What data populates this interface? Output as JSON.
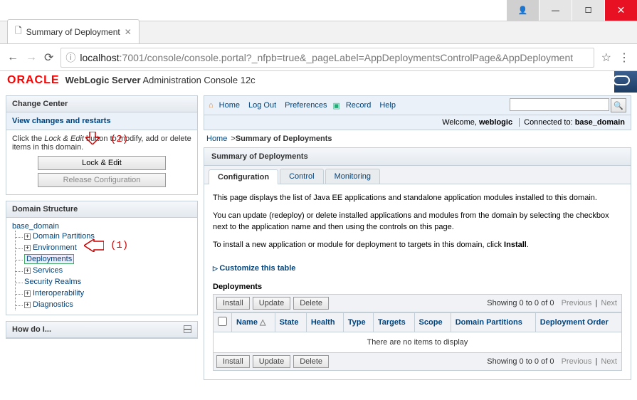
{
  "window": {
    "tab_title": "Summary of Deployment",
    "url_host": "localhost",
    "url_port": ":7001",
    "url_path": "/console/console.portal?_nfpb=true&_pageLabel=AppDeploymentsControlPage&AppDeployment"
  },
  "brand": {
    "logo": "ORACLE",
    "product": "WebLogic Server",
    "sub": "Administration Console 12c"
  },
  "toolbar": {
    "home": "Home",
    "logout": "Log Out",
    "prefs": "Preferences",
    "record": "Record",
    "help": "Help"
  },
  "welcome": {
    "greeting": "Welcome,",
    "user": "weblogic",
    "connected_label": "Connected to:",
    "domain": "base_domain"
  },
  "change_center": {
    "title": "Change Center",
    "view_link": "View changes and restarts",
    "instruction_pre": "Click the ",
    "instruction_em": "Lock & Edit",
    "instruction_post": " button to modify, add or delete items in this domain.",
    "lock_btn": "Lock & Edit",
    "release_btn": "Release Configuration"
  },
  "domain_structure": {
    "title": "Domain Structure",
    "root": "base_domain",
    "items": [
      {
        "label": "Domain Partitions",
        "expandable": true
      },
      {
        "label": "Environment",
        "expandable": true
      },
      {
        "label": "Deployments",
        "expandable": false,
        "selected": true
      },
      {
        "label": "Services",
        "expandable": true
      },
      {
        "label": "Security Realms",
        "expandable": false
      },
      {
        "label": "Interoperability",
        "expandable": true
      },
      {
        "label": "Diagnostics",
        "expandable": true
      }
    ]
  },
  "howdoi": {
    "title": "How do I..."
  },
  "breadcrumb": {
    "home": "Home",
    "current": "Summary of Deployments"
  },
  "page": {
    "title": "Summary of Deployments",
    "tabs": [
      {
        "label": "Configuration",
        "active": true
      },
      {
        "label": "Control"
      },
      {
        "label": "Monitoring"
      }
    ],
    "p1": "This page displays the list of Java EE applications and standalone application modules installed to this domain.",
    "p2": "You can update (redeploy) or delete installed applications and modules from the domain by selecting the checkbox next to the application name and then using the controls on this page.",
    "p3_pre": "To install a new application or module for deployment to targets in this domain, click ",
    "p3_bold": "Install",
    "p3_post": ".",
    "customize": "Customize this table",
    "table_title": "Deployments",
    "btn_install": "Install",
    "btn_update": "Update",
    "btn_delete": "Delete",
    "pager_showing": "Showing 0 to 0 of 0",
    "pager_prev": "Previous",
    "pager_next": "Next",
    "cols": [
      "Name",
      "State",
      "Health",
      "Type",
      "Targets",
      "Scope",
      "Domain Partitions",
      "Deployment Order"
    ],
    "empty": "There are no items to display"
  },
  "annotations": {
    "one": "(1)",
    "two": "(2)"
  }
}
